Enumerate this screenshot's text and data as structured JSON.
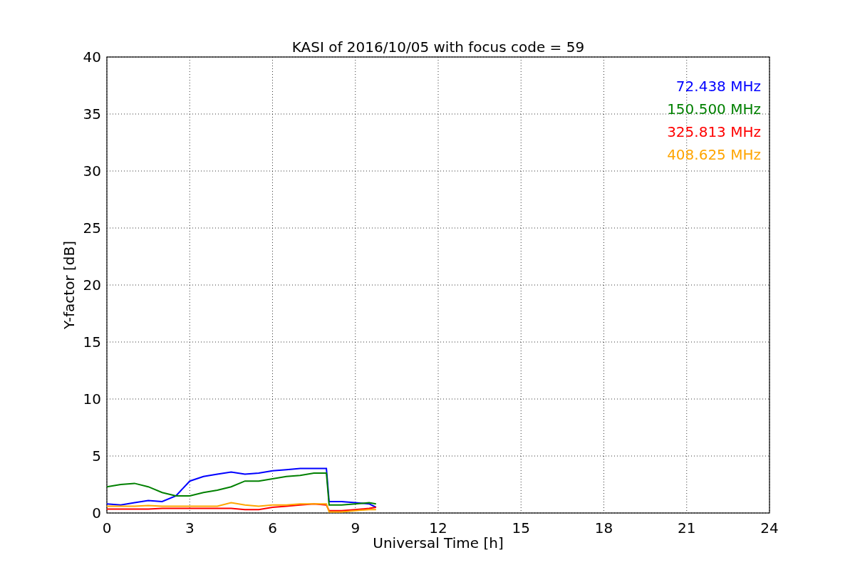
{
  "figure": {
    "chart_data": {
      "type": "line",
      "grid": true,
      "title": "KASI of 2016/10/05 with focus code = 59",
      "xlabel": "Universal Time [h]",
      "ylabel": "Y-factor [dB]",
      "xlim": [
        0,
        24
      ],
      "ylim": [
        0,
        40
      ],
      "xticks": [
        0,
        3,
        6,
        9,
        12,
        15,
        18,
        21,
        24
      ],
      "yticks": [
        0,
        5,
        10,
        15,
        20,
        25,
        30,
        35,
        40
      ],
      "x": [
        0,
        0.5,
        1,
        1.5,
        2,
        2.5,
        3,
        3.5,
        4,
        4.5,
        5,
        5.5,
        6,
        6.5,
        7,
        7.5,
        7.95,
        8.05,
        8.5,
        9,
        9.5,
        9.75
      ],
      "series": [
        {
          "name": "72.438 MHz",
          "color": "#0000ff",
          "values": [
            0.8,
            0.7,
            0.9,
            1.1,
            1.0,
            1.5,
            2.8,
            3.2,
            3.4,
            3.6,
            3.4,
            3.5,
            3.7,
            3.8,
            3.9,
            3.9,
            3.9,
            1.0,
            1.0,
            0.9,
            0.8,
            0.5
          ]
        },
        {
          "name": "150.500 MHz",
          "color": "#008000",
          "values": [
            2.3,
            2.5,
            2.6,
            2.3,
            1.8,
            1.5,
            1.5,
            1.8,
            2.0,
            2.3,
            2.8,
            2.8,
            3.0,
            3.2,
            3.3,
            3.5,
            3.5,
            0.7,
            0.7,
            0.8,
            0.9,
            0.8
          ]
        },
        {
          "name": "325.813 MHz",
          "color": "#ff0000",
          "values": [
            0.35,
            0.35,
            0.35,
            0.35,
            0.4,
            0.4,
            0.4,
            0.4,
            0.4,
            0.4,
            0.3,
            0.3,
            0.5,
            0.6,
            0.7,
            0.8,
            0.7,
            0.2,
            0.2,
            0.3,
            0.4,
            0.5
          ]
        },
        {
          "name": "408.625 MHz",
          "color": "#ffa500",
          "values": [
            0.6,
            0.6,
            0.6,
            0.65,
            0.6,
            0.6,
            0.6,
            0.6,
            0.6,
            0.9,
            0.7,
            0.6,
            0.7,
            0.7,
            0.8,
            0.8,
            0.8,
            0.1,
            0.1,
            0.2,
            0.3,
            0.3
          ]
        }
      ]
    }
  }
}
